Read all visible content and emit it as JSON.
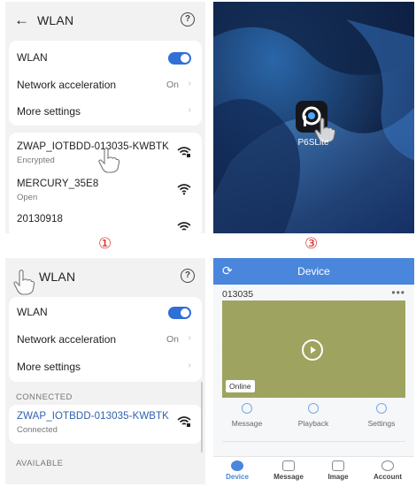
{
  "step_labels": {
    "first": "①",
    "third": "③"
  },
  "wlan_screen_1": {
    "back_icon": "arrow-left-icon",
    "title": "WLAN",
    "help_icon": "question-icon",
    "help_glyph": "?",
    "wlan_label": "WLAN",
    "wlan_enabled": true,
    "network_acceleration_label": "Network acceleration",
    "network_acceleration_value": "On",
    "more_settings_label": "More settings",
    "networks": [
      {
        "ssid": "ZWAP_IOTBDD-013035-KWBTK",
        "status": "Encrypted"
      },
      {
        "ssid": "MERCURY_35E8",
        "status": "Open"
      },
      {
        "ssid": "20130918",
        "status": ""
      }
    ]
  },
  "wlan_screen_2": {
    "title": "WLAN",
    "help_glyph": "?",
    "wlan_label": "WLAN",
    "wlan_enabled": true,
    "network_acceleration_label": "Network acceleration",
    "network_acceleration_value": "On",
    "more_settings_label": "More settings",
    "connected_header": "CONNECTED",
    "connected_network": {
      "ssid": "ZWAP_IOTBDD-013035-KWBTK",
      "status": "Connected"
    },
    "available_header": "AVAILABLE"
  },
  "desktop_screen": {
    "app_label": "P6SLite",
    "app_icon": "p6slite-app-icon"
  },
  "app_screen": {
    "header_title": "Device",
    "refresh_icon": "refresh-icon",
    "device_name": "013035",
    "more_glyph": "•••",
    "online_badge": "Online",
    "actions": [
      {
        "label": "Message",
        "icon": "message-icon"
      },
      {
        "label": "Playback",
        "icon": "playback-icon"
      },
      {
        "label": "Settings",
        "icon": "settings-icon"
      }
    ],
    "tabs": [
      {
        "label": "Device",
        "icon": "device-icon",
        "active": true
      },
      {
        "label": "Message",
        "icon": "message-icon",
        "active": false
      },
      {
        "label": "Image",
        "icon": "image-icon",
        "active": false
      },
      {
        "label": "Account",
        "icon": "account-icon",
        "active": false
      }
    ]
  },
  "colors": {
    "accent_blue": "#2f6fd6",
    "app_header_blue": "#4a86db",
    "connected_text": "#2f5fb0",
    "step_label_red": "#d8302a"
  }
}
